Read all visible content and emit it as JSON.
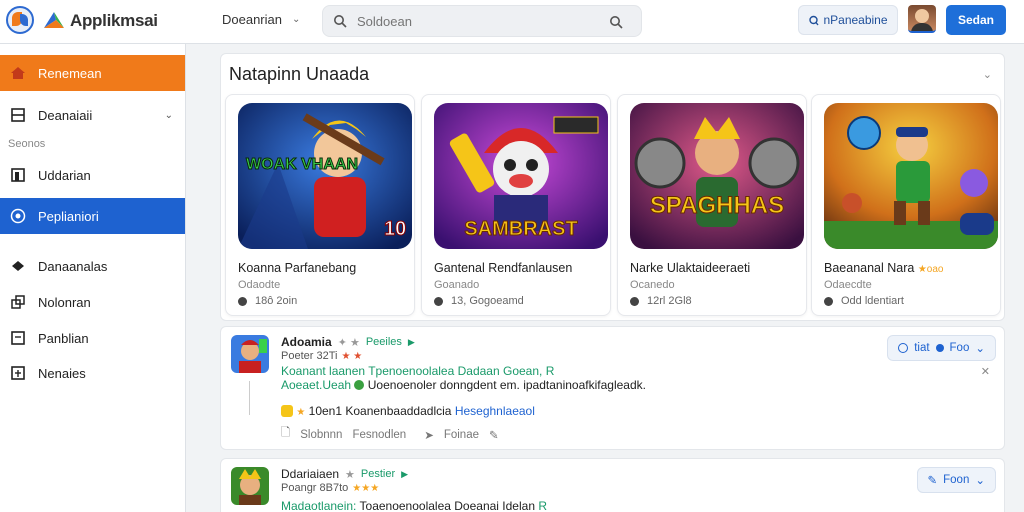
{
  "app": {
    "title": "Applikmsai"
  },
  "topbar": {
    "menu_label": "Doeanrian",
    "search_placeholder": "Soldoean",
    "notif_label": "nPaneabine",
    "primary_button": "Sedan"
  },
  "sidebar": {
    "items": [
      {
        "label": "Renemean",
        "icon": "home-icon"
      },
      {
        "label": "Deanaiaii",
        "icon": "inbox-icon"
      },
      {
        "label": "Uddarian",
        "icon": "book-icon"
      },
      {
        "label": "Peplianiori",
        "icon": "target-icon"
      },
      {
        "label": "Danaanalas",
        "icon": "diamond-icon"
      },
      {
        "label": "Nolonran",
        "icon": "stack-icon"
      },
      {
        "label": "Panblian",
        "icon": "doc-icon"
      },
      {
        "label": "Nenaies",
        "icon": "calendar-icon"
      }
    ],
    "section_label": "Seonos"
  },
  "featured": {
    "title": "Natapinn Unaada",
    "cards": [
      {
        "art_text": "WOAK VHAAN",
        "title": "Koanna Parfanebang",
        "sub": "Odaodte",
        "meta": "18ô 2oin"
      },
      {
        "art_text": "SAMBRAST",
        "title": "Gantenal Rendfanlausen",
        "sub": "Goanado",
        "meta": "13, Gogoeamd"
      },
      {
        "art_text": "SPAGHHAS",
        "title": "Narke Ulaktaideeraeti",
        "sub": "Ocanedo",
        "meta": "12rl 2Gl8"
      },
      {
        "art_text": "",
        "title": "Baeananal Nara",
        "sub": "Odaecdte",
        "meta": "Odd ldentiart",
        "badge": "★oao"
      }
    ]
  },
  "feed": [
    {
      "name": "Adoamia",
      "role": "Peeiles",
      "sub": "Poeter 32Ti",
      "line1_g": "Koanant laanen",
      "line1_rest": "Tpenoenoolalea Dadaan Goean,",
      "line1_tail": "R",
      "line2_g": "Aoeaet.Ueah",
      "line2_rest": "Uoenoenoler donngdent em. ipadtaninoafkifagleadk.",
      "line3_k": "10en1 Koanenbaaddadlcia",
      "line3_b": "Heseghnlaeaol",
      "act1": "Slobnnn",
      "act2": "Fesnodlen",
      "act3": "Foinae",
      "follow_label": "tiat",
      "follow_label2": "Foo"
    },
    {
      "name": "Ddariaiaen",
      "role": "Pestier",
      "sub": "Poangr 8B7to",
      "line1_g": "Madaotlanein:",
      "line1_rest": "Toaenoenoolalea Doeanai Idelan",
      "line1_tail": "R",
      "follow_label": "Foon"
    }
  ]
}
